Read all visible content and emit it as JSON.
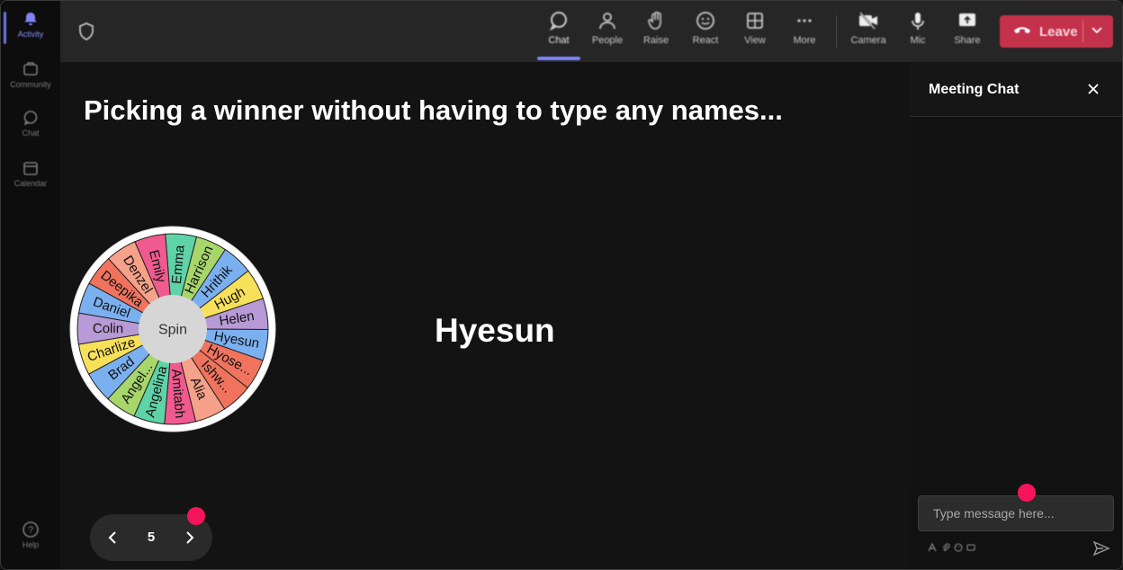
{
  "sidebar": {
    "items": [
      {
        "label": "Activity",
        "icon": "bell-icon"
      },
      {
        "label": "Community",
        "icon": "community-icon"
      },
      {
        "label": "Chat",
        "icon": "chat-icon"
      },
      {
        "label": "Calendar",
        "icon": "calendar-icon"
      }
    ],
    "help_label": "Help"
  },
  "toolbar": {
    "chat": "Chat",
    "people": "People",
    "raise": "Raise",
    "react": "React",
    "view": "View",
    "more": "More",
    "camera": "Camera",
    "mic": "Mic",
    "share": "Share",
    "leave": "Leave"
  },
  "stage": {
    "headline": "Picking a winner without having to type any names...",
    "winner": "Hyesun",
    "spin_label": "Spin",
    "wheel_names": [
      "Emma",
      "Harrison",
      "Hrithik",
      "Hugh",
      "Helen",
      "Hyesun",
      "Hyose...",
      "Ishw...",
      "Alia",
      "Amitabh",
      "Angelina",
      "Angel...",
      "Brad",
      "Charlize",
      "Colin",
      "Daniel",
      "Deepika",
      "Denzel",
      "Emily"
    ],
    "wheel_colors": [
      "#5fd3a8",
      "#a7d66a",
      "#7bb0f0",
      "#f7e05a",
      "#b79ad6",
      "#7bb0f0",
      "#f0735e",
      "#f0735e",
      "#f7a08a",
      "#f05a8e",
      "#5fd3a8",
      "#a7d66a",
      "#7bb0f0",
      "#f7e05a",
      "#b79ad6",
      "#7bb0f0",
      "#f0735e",
      "#f7a08a",
      "#f05a8e"
    ],
    "page_number": "5"
  },
  "chat": {
    "title": "Meeting Chat",
    "input_placeholder": "Type message here..."
  },
  "colors": {
    "accent": "#7f85f5",
    "leave": "#c4314b",
    "indicator": "#f5145c"
  }
}
